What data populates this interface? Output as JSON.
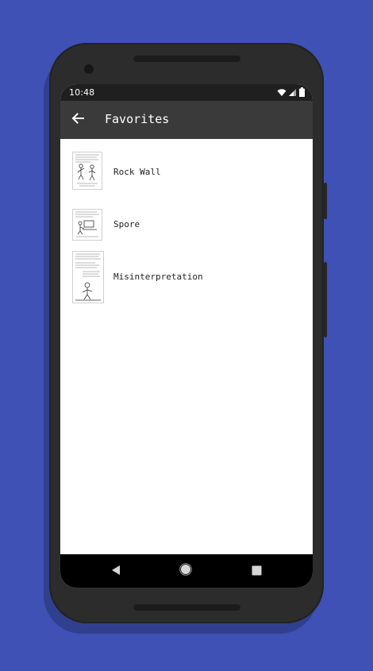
{
  "status_bar": {
    "time": "10:48",
    "icons": [
      "wifi-icon",
      "cell-signal-icon",
      "battery-icon"
    ]
  },
  "app_bar": {
    "title": "Favorites",
    "back_icon": "arrow-back-icon"
  },
  "favorites": [
    {
      "title": "Rock Wall",
      "thumbnail": "comic-thumbnail"
    },
    {
      "title": "Spore",
      "thumbnail": "comic-thumbnail"
    },
    {
      "title": "Misinterpretation",
      "thumbnail": "comic-thumbnail"
    }
  ],
  "navigation": {
    "back": "nav-back-icon",
    "home": "nav-home-icon",
    "recents": "nav-recents-icon"
  },
  "colors": {
    "background": "#3f51b5",
    "app_bar": "#3a3a3a",
    "status_bar": "#1f1f1f",
    "phone_frame": "#2c2c2c",
    "nav_bar": "#000000"
  }
}
